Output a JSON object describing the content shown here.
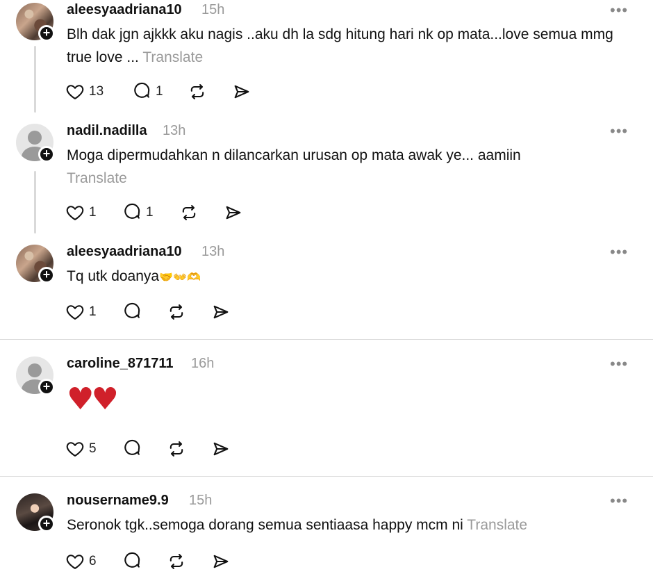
{
  "posts": [
    {
      "username": "aleesyaadriana10",
      "time": "15h",
      "text": "Blh dak jgn ajkkk aku nagis ..aku dh la sdg hitung hari nk op mata...love semua mmg true love ...",
      "translate": "Translate",
      "likes": "13",
      "replies": "1",
      "avatar": "photo"
    },
    {
      "username": "nadil.nadilla",
      "time": "13h",
      "text": "Moga dipermudahkan n dilancarkan urusan op mata awak ye... aamiin",
      "translate": "Translate",
      "likes": "1",
      "replies": "1",
      "avatar": "default"
    },
    {
      "username": "aleesyaadriana10",
      "time": "13h",
      "text": "Tq utk doanya",
      "emoji": "🤝👐🫶",
      "likes": "1",
      "avatar": "photo"
    },
    {
      "username": "caroline_871711",
      "time": "16h",
      "emoji": "♥♥",
      "likes": "5",
      "avatar": "default"
    },
    {
      "username": "nousername9.9",
      "time": "15h",
      "text": "Seronok tgk..semoga dorang semua sentiaasa happy mcm ni",
      "translate": "Translate",
      "likes": "6",
      "avatar": "photo"
    }
  ],
  "more_label": "•••",
  "plus_label": "+"
}
